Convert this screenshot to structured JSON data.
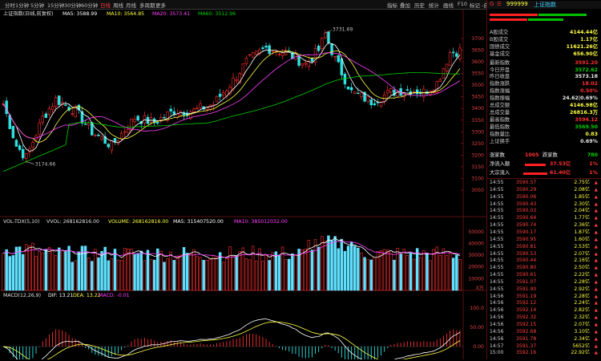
{
  "toolbar": {
    "left_items": [
      "分时",
      "1分钟",
      "5分钟",
      "15分钟",
      "30分钟",
      "60分钟",
      "日线",
      "周线",
      "月线",
      "多周期",
      "更多"
    ],
    "active_index": 6,
    "right_items": [
      "指标",
      "叠加",
      "历史",
      "统计",
      "画线",
      "F10",
      "标记",
      "-自选"
    ]
  },
  "chart_title": {
    "name": "上证指数(日线,前复权)",
    "ma5": "MA5: 3588.99",
    "ma10": "MA10: 3564.85",
    "ma20": "MA20: 3573.41",
    "ma60": "MA60: 3512.96"
  },
  "annotations": {
    "high": "3731.69",
    "low": "3174.66"
  },
  "price_axis": [
    "3700",
    "3650",
    "3600",
    "3550",
    "3500",
    "3450",
    "3400",
    "3350",
    "3300",
    "3250",
    "3200",
    "3150",
    "3100",
    "3050"
  ],
  "volume_title": {
    "name": "VOL-TDX(5,10)",
    "vvol": "VVOL: 268162816.00",
    "volume": "VOLUME: 268162816.00",
    "ma5": "MA5: 315407520.00",
    "ma10": "MA10: 385012032.00"
  },
  "volume_axis": [
    "50000",
    "40000",
    "30000",
    "20000",
    "10000"
  ],
  "volume_unit": "X万",
  "macd_title": {
    "name": "MACD(12,26,9)",
    "dif": "DIF: 13.21",
    "dea": "DEA: 13.22",
    "macd": "MACD: -0.01"
  },
  "macd_axis": [
    "100.0",
    "50.00",
    "0.00"
  ],
  "quote": {
    "code": "999999",
    "name": "上证指数",
    "prefix": "G",
    "rows": [
      {
        "label": "A股成交",
        "value": "4144.44亿",
        "color": "yellow"
      },
      {
        "label": "B股成交",
        "value": "1.17亿",
        "color": "yellow"
      },
      {
        "label": "国债成交",
        "value": "11621.26亿",
        "color": "yellow"
      },
      {
        "label": "基金成交",
        "value": "656.90亿",
        "color": "yellow"
      },
      {
        "label": "最新指数",
        "value": "3591.20",
        "color": "red"
      },
      {
        "label": "今日开盘",
        "value": "3572.62",
        "color": "green"
      },
      {
        "label": "昨日收盘",
        "value": "3573.18",
        "color": "white"
      },
      {
        "label": "指数涨跌",
        "value": "18.02",
        "color": "red"
      },
      {
        "label": "指数涨幅",
        "value": "0.50%",
        "color": "red"
      },
      {
        "label": "指数振幅",
        "value": "24.62|0.69%",
        "color": "white"
      },
      {
        "label": "总成交额",
        "value": "4146.98亿",
        "color": "yellow"
      },
      {
        "label": "总成交量",
        "value": "26816.3万",
        "color": "yellow"
      },
      {
        "label": "最高指数",
        "value": "3594.12",
        "color": "red"
      },
      {
        "label": "最低指数",
        "value": "3569.50",
        "color": "green"
      },
      {
        "label": "指数量比",
        "value": "0.83",
        "color": "yellow"
      },
      {
        "label": "上证换手",
        "value": "0.69%",
        "color": "white"
      }
    ],
    "updown": {
      "up_label": "涨家数",
      "up": "1005",
      "down_label": "跌家数",
      "down": "780"
    },
    "flows": [
      {
        "label": "净流入额",
        "value": "37.53亿",
        "pct": "1%"
      },
      {
        "label": "大宗流入",
        "value": "61.40亿",
        "pct": "1%"
      }
    ]
  },
  "ticks": [
    {
      "t": "14:55",
      "p": "3590.57",
      "v": "2.75亿"
    },
    {
      "t": "14:55",
      "p": "3590.29",
      "v": "2.08亿"
    },
    {
      "t": "14:55",
      "p": "3590.06",
      "v": "1.85亿"
    },
    {
      "t": "14:55",
      "p": "3590.43",
      "v": "2.30亿"
    },
    {
      "t": "14:55",
      "p": "3590.03",
      "v": "2.04亿"
    },
    {
      "t": "14:55",
      "p": "3590.64",
      "v": "1.77亿"
    },
    {
      "t": "14:55",
      "p": "3590.74",
      "v": "2.36亿"
    },
    {
      "t": "14:55",
      "p": "3590.17",
      "v": "1.87亿"
    },
    {
      "t": "14:55",
      "p": "3590.95",
      "v": "1.60亿"
    },
    {
      "t": "14:55",
      "p": "3590.81",
      "v": "2.53亿"
    },
    {
      "t": "14:55",
      "p": "3590.53",
      "v": "2.07亿"
    },
    {
      "t": "14:55",
      "p": "3590.44",
      "v": "2.16亿"
    },
    {
      "t": "14:55",
      "p": "3590.80",
      "v": "2.50亿"
    },
    {
      "t": "14:55",
      "p": "3590.61",
      "v": "2.22亿"
    },
    {
      "t": "14:55",
      "p": "3591.07",
      "v": "2.28亿"
    },
    {
      "t": "14:55",
      "p": "3591.90",
      "v": "2.92亿"
    },
    {
      "t": "14:56",
      "p": "3591.19",
      "v": "2.28亿"
    },
    {
      "t": "14:56",
      "p": "3592.12",
      "v": "2.24亿"
    },
    {
      "t": "14:56",
      "p": "3592.14",
      "v": "2.82亿"
    },
    {
      "t": "14:56",
      "p": "3592.32",
      "v": "2.32亿"
    },
    {
      "t": "14:56",
      "p": "3592.15",
      "v": "2.07亿"
    },
    {
      "t": "14:56",
      "p": "3592.68",
      "v": "3.10亿"
    },
    {
      "t": "14:56",
      "p": "3591.78",
      "v": "2.34亿"
    },
    {
      "t": "14:57",
      "p": "3591.37",
      "v": "5652亿"
    },
    {
      "t": "15:00",
      "p": "3592.16",
      "v": "22.92亿"
    }
  ]
}
